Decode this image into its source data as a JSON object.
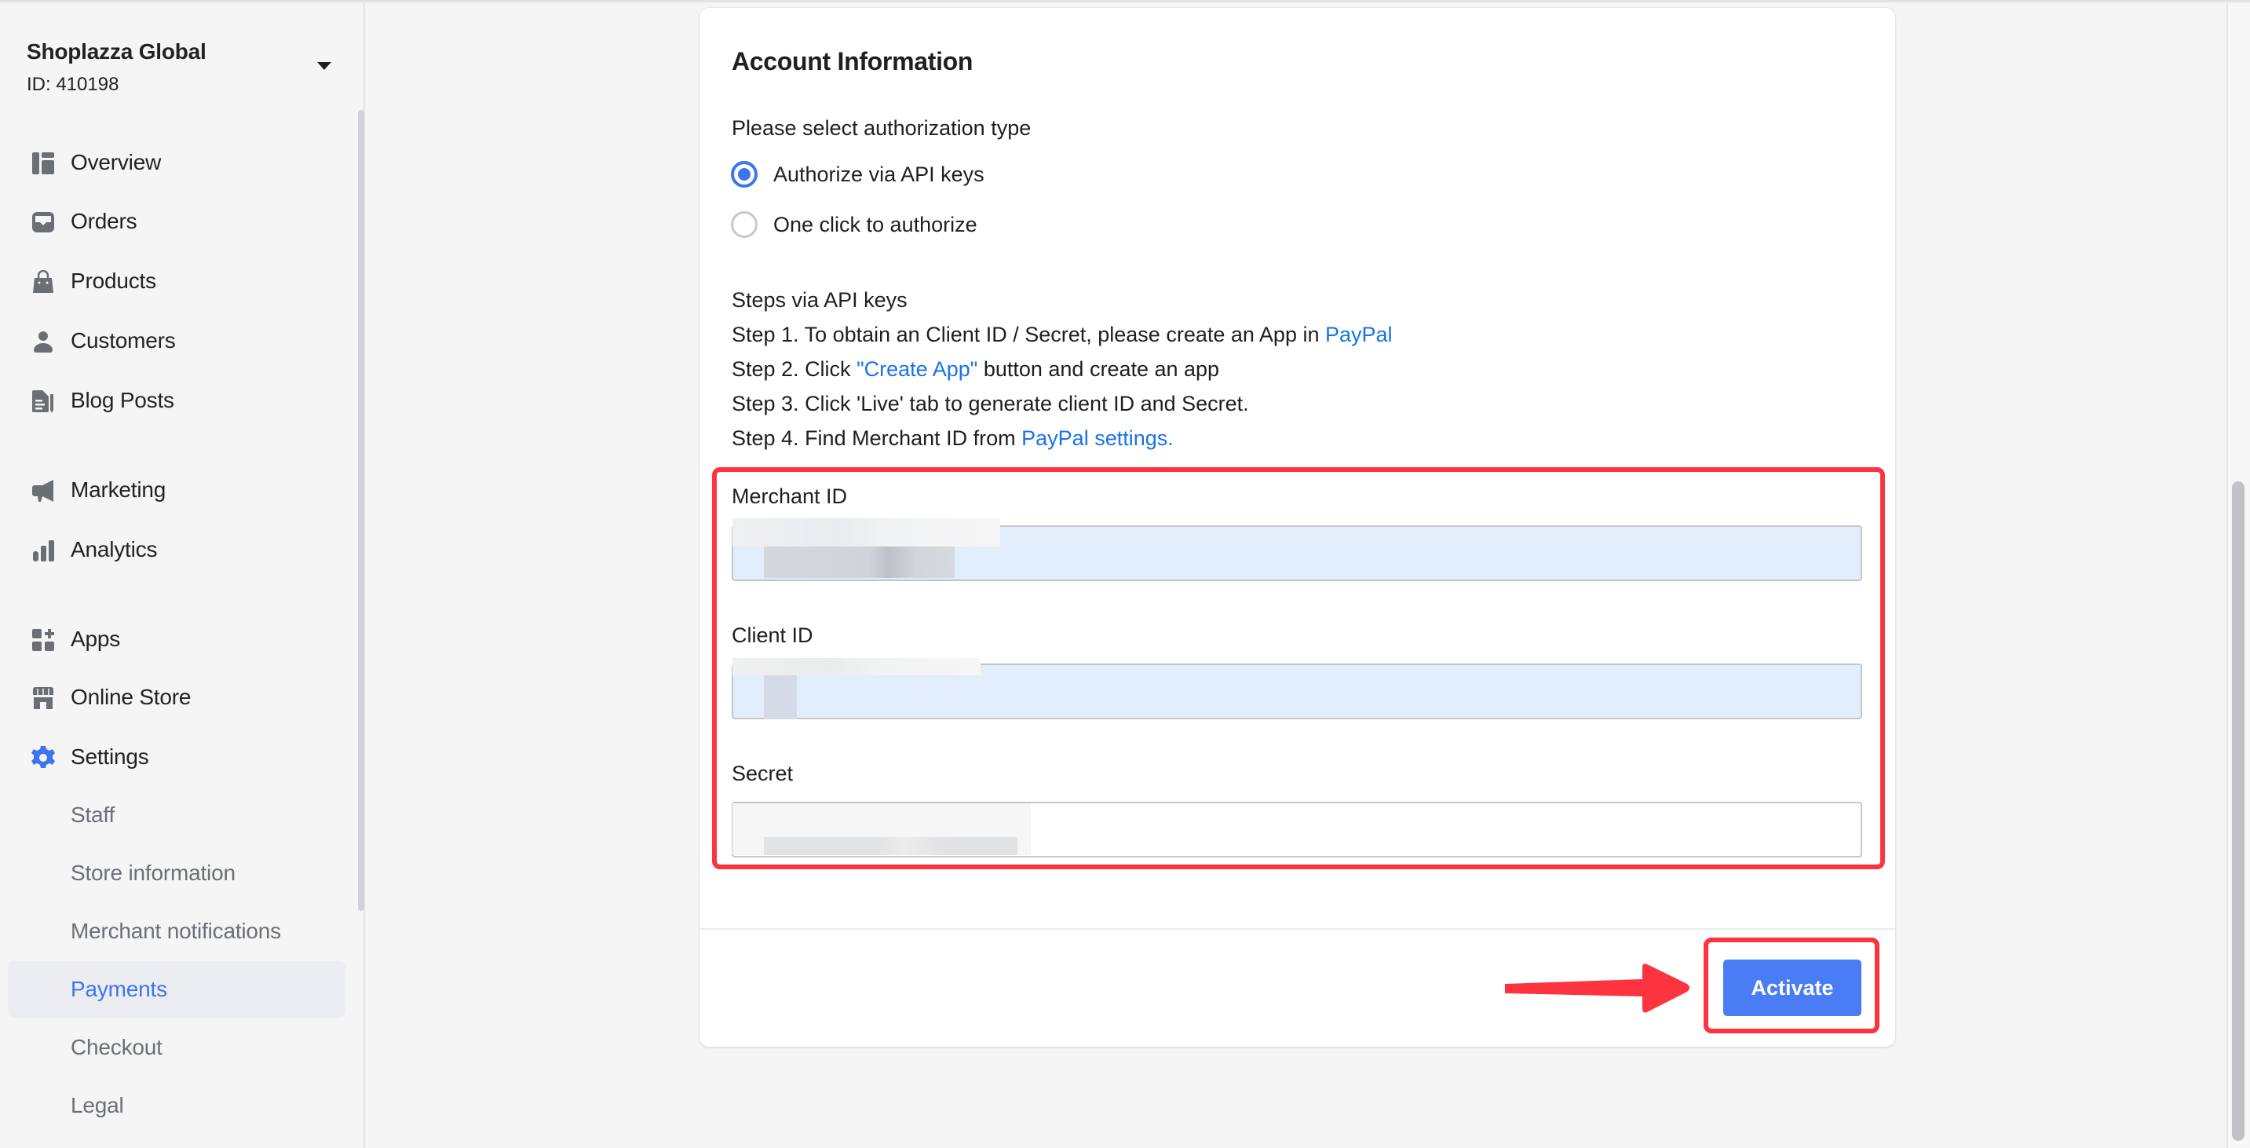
{
  "store": {
    "name": "Shoplazza Global",
    "id_label": "ID: 410198"
  },
  "sidebar": {
    "items": [
      {
        "label": "Overview",
        "icon": "overview-icon"
      },
      {
        "label": "Orders",
        "icon": "orders-inbox-icon"
      },
      {
        "label": "Products",
        "icon": "shopping-bag-icon"
      },
      {
        "label": "Customers",
        "icon": "person-icon"
      },
      {
        "label": "Blog Posts",
        "icon": "blog-document-icon"
      },
      {
        "label": "Marketing",
        "icon": "megaphone-icon"
      },
      {
        "label": "Analytics",
        "icon": "bar-chart-icon"
      },
      {
        "label": "Apps",
        "icon": "apps-grid-icon"
      },
      {
        "label": "Online Store",
        "icon": "storefront-icon"
      },
      {
        "label": "Settings",
        "icon": "gear-icon"
      }
    ],
    "settings_sub": [
      {
        "label": "Staff"
      },
      {
        "label": "Store information"
      },
      {
        "label": "Merchant notifications"
      },
      {
        "label": "Payments",
        "active": true
      },
      {
        "label": "Checkout"
      },
      {
        "label": "Legal"
      }
    ]
  },
  "card": {
    "title": "Account Information",
    "auth_prompt": "Please select authorization type",
    "auth_options": [
      {
        "label": "Authorize via API keys",
        "selected": true
      },
      {
        "label": "One click to authorize",
        "selected": false
      }
    ],
    "steps": {
      "heading": "Steps via API keys",
      "step1_text": "Step 1. To obtain an Client ID / Secret, please create an App in ",
      "step1_link": "PayPal",
      "step2_pre": "Step 2. Click ",
      "step2_link": "\"Create App\"",
      "step2_post": " button and create an app",
      "step3_text": "Step 3. Click 'Live' tab to generate client ID and Secret.",
      "step4_text": "Step 4. Find Merchant ID from ",
      "step4_link": "PayPal settings."
    },
    "fields": {
      "merchant_id": {
        "label": "Merchant ID",
        "value": ""
      },
      "client_id": {
        "label": "Client ID",
        "value": ""
      },
      "secret": {
        "label": "Secret",
        "value": ""
      }
    },
    "activate_label": "Activate"
  },
  "colors": {
    "accent": "#3e74ee",
    "button": "#4a7cf6",
    "link": "#1a73e8",
    "annotation_red": "#fd333f",
    "autofill_bg": "#e3eefc"
  }
}
